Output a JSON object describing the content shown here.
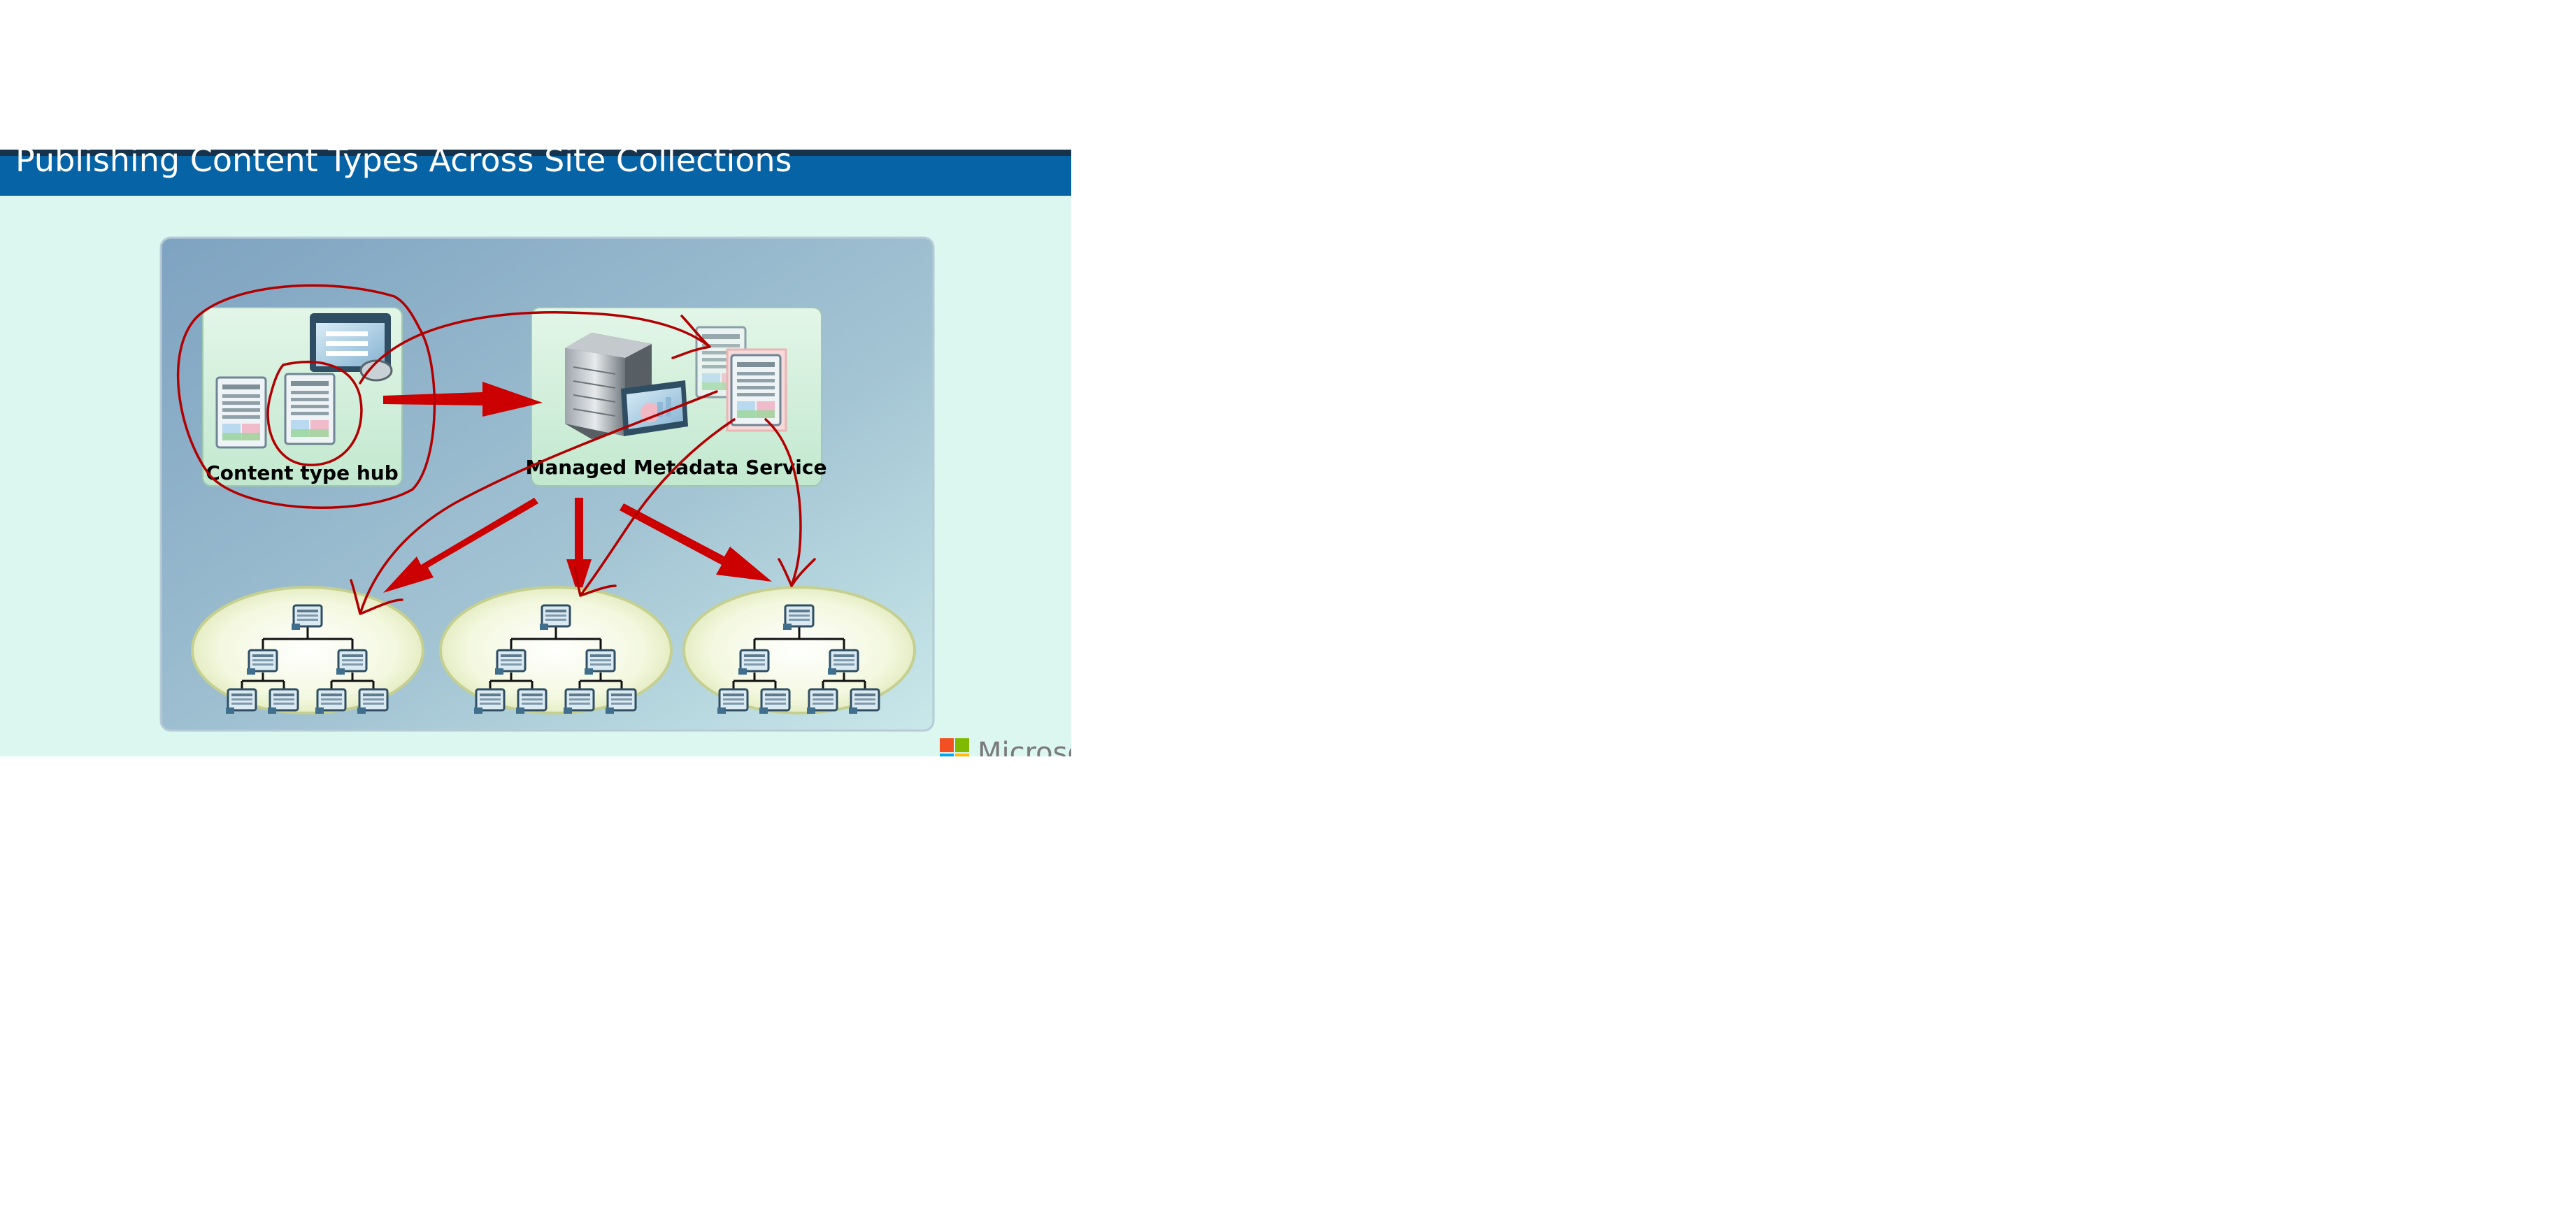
{
  "slide": {
    "title": "Publishing Content Types Across Site Collections"
  },
  "diagram": {
    "hub_label": "Content type hub",
    "service_label": "Managed Metadata Service",
    "site_collection_count": 3
  },
  "branding": {
    "logo_text": "Microso"
  },
  "colors": {
    "title_bar": "#0563a6",
    "top_rule": "#17324b",
    "slide_background": "#dcf6f0",
    "diagram_panel_from": "#7fa4c1",
    "diagram_panel_to": "#c7e7e9",
    "box_fill": "#ccecd8",
    "ellipse_fill": "#eef6d3",
    "arrow_red": "#cc0000",
    "ink_red": "#b20000"
  }
}
